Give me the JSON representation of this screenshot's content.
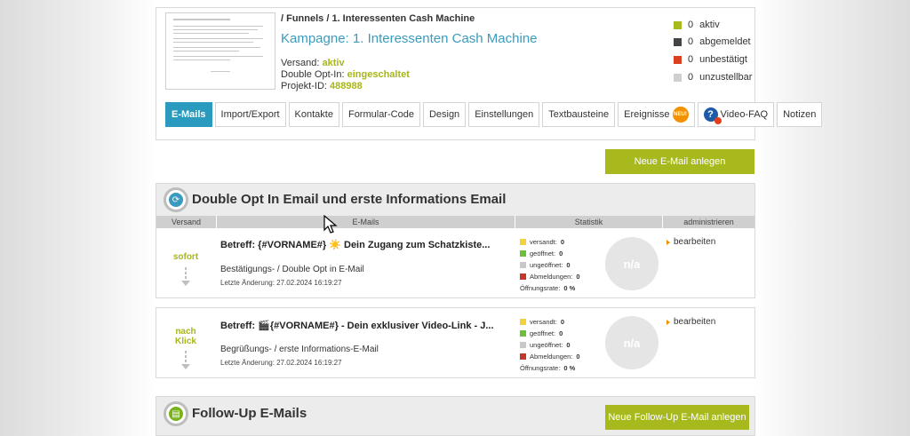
{
  "header": {
    "breadcrumb": "/ Funnels / 1. Interessenten Cash Machine",
    "campaign_title": "Kampagne: 1. Interessenten Cash Machine",
    "versand_label": "Versand:",
    "versand_value": "aktiv",
    "doi_label": "Double Opt-In:",
    "doi_value": "eingeschaltet",
    "project_label": "Projekt-ID:",
    "project_value": "488988"
  },
  "legend": [
    {
      "count": "0",
      "label": "aktiv",
      "color": "#a8b91d"
    },
    {
      "count": "0",
      "label": "abgemeldet",
      "color": "#444444"
    },
    {
      "count": "0",
      "label": "unbestätigt",
      "color": "#d9401f"
    },
    {
      "count": "0",
      "label": "unzustellbar",
      "color": "#cfcfcf"
    }
  ],
  "tabs": [
    {
      "label": "E-Mails",
      "active": true
    },
    {
      "label": "Import/Export"
    },
    {
      "label": "Kontakte"
    },
    {
      "label": "Formular-Code"
    },
    {
      "label": "Design"
    },
    {
      "label": "Einstellungen"
    },
    {
      "label": "Textbausteine"
    },
    {
      "label": "Ereignisse",
      "badge": "NEU!"
    },
    {
      "label": "Video-FAQ",
      "icon": "help-video-icon"
    },
    {
      "label": "Notizen"
    }
  ],
  "new_email_button": "Neue E-Mail anlegen",
  "section": {
    "title": "Double Opt In Email und erste Informations Email",
    "columns": [
      "Versand",
      "E-Mails",
      "Statistik",
      "administrieren"
    ]
  },
  "emails": [
    {
      "when": "sofort",
      "subject": "Betreff: {#VORNAME#} ☀️ Dein Zugang zum Schatzkiste...",
      "description": "Bestätigungs- / Double Opt in E-Mail",
      "changed": "Letzte Änderung: 27.02.2024 16:19:27",
      "stats": [
        {
          "label": "versandt:",
          "value": "0",
          "color": "#f2d23a"
        },
        {
          "label": "geöffnet:",
          "value": "0",
          "color": "#6cbf3a"
        },
        {
          "label": "ungeöffnet:",
          "value": "0",
          "color": "#c8c8c8"
        },
        {
          "label": "Abmeldungen:",
          "value": "0",
          "color": "#c0392b"
        },
        {
          "label": "Öffnungsrate:",
          "value": "0 %"
        }
      ],
      "chart_placeholder": "n/a",
      "edit": "bearbeiten"
    },
    {
      "when_line1": "nach",
      "when_line2": "Klick",
      "subject": "Betreff: 🎬{#VORNAME#} - Dein exklusiver Video-Link - J...",
      "description": "Begrüßungs- / erste Informations-E-Mail",
      "changed": "Letzte Änderung: 27.02.2024 16:19:27",
      "stats": [
        {
          "label": "versandt:",
          "value": "0",
          "color": "#f2d23a"
        },
        {
          "label": "geöffnet:",
          "value": "0",
          "color": "#6cbf3a"
        },
        {
          "label": "ungeöffnet:",
          "value": "0",
          "color": "#c8c8c8"
        },
        {
          "label": "Abmeldungen:",
          "value": "0",
          "color": "#c0392b"
        },
        {
          "label": "Öffnungsrate:",
          "value": "0 %"
        }
      ],
      "chart_placeholder": "n/a",
      "edit": "bearbeiten"
    }
  ],
  "followup": {
    "title": "Follow-Up E-Mails",
    "button": "Neue Follow-Up E-Mail anlegen"
  }
}
